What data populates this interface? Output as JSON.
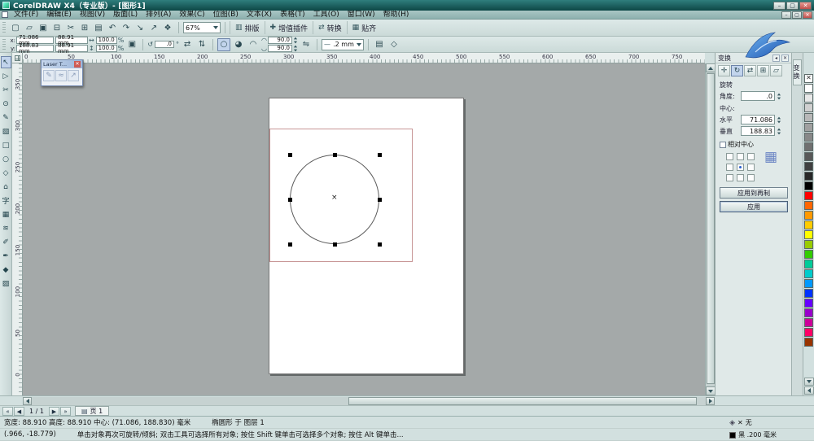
{
  "window": {
    "title": "CorelDRAW X4（专业版）- [图形1]",
    "minimize_icon": "–",
    "maximize_icon": "▢",
    "close_icon": "✕"
  },
  "menu": {
    "items": [
      {
        "name": "menu-file",
        "label": "文件(F)"
      },
      {
        "name": "menu-edit",
        "label": "编辑(E)"
      },
      {
        "name": "menu-view",
        "label": "视图(V)"
      },
      {
        "name": "menu-layout",
        "label": "版面(L)"
      },
      {
        "name": "menu-arrange",
        "label": "排列(A)"
      },
      {
        "name": "menu-effects",
        "label": "效果(C)"
      },
      {
        "name": "menu-bitmaps",
        "label": "位图(B)"
      },
      {
        "name": "menu-text",
        "label": "文本(X)"
      },
      {
        "name": "menu-table",
        "label": "表格(T)"
      },
      {
        "name": "menu-tools",
        "label": "工具(O)"
      },
      {
        "name": "menu-window",
        "label": "窗口(W)"
      },
      {
        "name": "menu-help",
        "label": "帮助(H)"
      }
    ]
  },
  "std_toolbar": {
    "icons": [
      {
        "name": "new-document-icon",
        "glyph": "▢"
      },
      {
        "name": "open-icon",
        "glyph": "▱"
      },
      {
        "name": "save-icon",
        "glyph": "▣"
      },
      {
        "name": "print-icon",
        "glyph": "⊟"
      },
      {
        "name": "cut-icon",
        "glyph": "✂"
      },
      {
        "name": "copy-icon",
        "glyph": "⊞"
      },
      {
        "name": "paste-icon",
        "glyph": "▤"
      },
      {
        "name": "undo-icon",
        "glyph": "↶"
      },
      {
        "name": "redo-icon",
        "glyph": "↷"
      },
      {
        "name": "import-icon",
        "glyph": "↘"
      },
      {
        "name": "export-icon",
        "glyph": "↗"
      },
      {
        "name": "app-launcher-icon",
        "glyph": "❖"
      }
    ],
    "zoom_value": "67%",
    "right_buttons": [
      {
        "name": "layout-button",
        "icon": "▥",
        "label": "排版"
      },
      {
        "name": "plugins-button",
        "icon": "✚",
        "label": "增值插件"
      },
      {
        "name": "convert-button",
        "icon": "⇄",
        "label": "转换"
      },
      {
        "name": "snap-button",
        "icon": "▦",
        "label": "贴齐"
      }
    ]
  },
  "property_bar": {
    "x_label": "x:",
    "x_value": "71.086 mm",
    "y_label": "y:",
    "y_value": "188.83 mm",
    "w_value": "88.91 mm",
    "h_value": "88.91 mm",
    "w_icon": "↔",
    "h_icon": "↕",
    "scale_h": "100.0",
    "scale_v": "100.0",
    "percent": "%",
    "lock_icon": "▣",
    "rotate_icon": "↺",
    "angle_value": ".0",
    "degree": "°",
    "mirror_h_icon": "⇄",
    "mirror_v_icon": "⇅",
    "ellipse_icon": "○",
    "pie_icon": "◕",
    "arc_icon": "◠",
    "arc_start_icon": "◠",
    "arc_start": "90.0",
    "arc_end_icon": "◡",
    "arc_end": "90.0",
    "direction_icon": "⇋",
    "outline_icon": "—",
    "outline_value": ".2 mm",
    "wrap_icon": "▤",
    "curves_icon": "◇"
  },
  "rulers": {
    "h_labels": [
      "0",
      "50",
      "100",
      "150",
      "200",
      "250",
      "300",
      "350",
      "400",
      "450",
      "500",
      "550",
      "600",
      "650",
      "700",
      "750"
    ],
    "v_labels": [
      "350",
      "300",
      "250",
      "200",
      "150",
      "100",
      "50",
      "0"
    ]
  },
  "toolbox": [
    {
      "name": "pick-tool",
      "glyph": "↖"
    },
    {
      "name": "shape-tool",
      "glyph": "▷"
    },
    {
      "name": "crop-tool",
      "glyph": "✂"
    },
    {
      "name": "zoom-tool",
      "glyph": "⊙"
    },
    {
      "name": "freehand-tool",
      "glyph": "✎"
    },
    {
      "name": "smart-fill-tool",
      "glyph": "▧"
    },
    {
      "name": "rectangle-tool",
      "glyph": "□"
    },
    {
      "name": "ellipse-tool",
      "glyph": "○"
    },
    {
      "name": "polygon-tool",
      "glyph": "◇"
    },
    {
      "name": "basic-shapes-tool",
      "glyph": "⌂"
    },
    {
      "name": "text-tool",
      "glyph": "字"
    },
    {
      "name": "table-tool",
      "glyph": "▦"
    },
    {
      "name": "blend-tool",
      "glyph": "≋"
    },
    {
      "name": "eyedropper-tool",
      "glyph": "✐"
    },
    {
      "name": "outline-pen-tool",
      "glyph": "✒"
    },
    {
      "name": "fill-tool",
      "glyph": "◆"
    },
    {
      "name": "interactive-fill-tool",
      "glyph": "▨"
    }
  ],
  "canvas": {
    "center_mark": "×"
  },
  "floating_toolbar": {
    "title": "Laser T...",
    "close_icon": "✕",
    "icons": [
      {
        "name": "laser-pen-icon",
        "glyph": "✎"
      },
      {
        "name": "laser-path-icon",
        "glyph": "≈"
      },
      {
        "name": "laser-arrow-icon",
        "glyph": "↗"
      }
    ]
  },
  "docker": {
    "title": "变换",
    "flyout_icon": "◂",
    "close_icon": "✕",
    "tabs": [
      {
        "name": "position-tab",
        "glyph": "✛"
      },
      {
        "name": "rotate-tab",
        "glyph": "↻"
      },
      {
        "name": "scale-mirror-tab",
        "glyph": "⇄"
      },
      {
        "name": "size-tab",
        "glyph": "⊞"
      },
      {
        "name": "skew-tab",
        "glyph": "▱"
      }
    ],
    "section_label": "旋转",
    "angle_label": "角度:",
    "angle_value": ".0",
    "center_label": "中心:",
    "horizontal_label": "水平",
    "horizontal_value": "71.086",
    "vertical_label": "垂直",
    "vertical_value": "188.83",
    "relative_center_label": "相对中心",
    "anchor_icon": "▦",
    "apply_duplicate_label": "应用到再制",
    "apply_label": "应用",
    "side_tab_label": "变换"
  },
  "palette": {
    "colors": [
      "#FFFFFF",
      "#E8E8E8",
      "#D0D0D0",
      "#B8B8B8",
      "#A0A0A0",
      "#888888",
      "#707070",
      "#585858",
      "#404040",
      "#282828",
      "#000000",
      "#FF0000",
      "#FF6600",
      "#FF9900",
      "#FFCC00",
      "#FFFF00",
      "#99CC00",
      "#33CC00",
      "#00CC99",
      "#00CCCC",
      "#0099FF",
      "#0033FF",
      "#6600FF",
      "#9900CC",
      "#CC0099",
      "#FF0066",
      "#993300"
    ]
  },
  "pagebar": {
    "first_icon": "«",
    "prev_icon": "◀",
    "indicator": "1 / 1",
    "next_icon": "▶",
    "last_icon": "»",
    "tab_icon": "▤",
    "tab_label": "页 1"
  },
  "statusbar": {
    "dims": "宽度: 88.910  高度: 88.910  中心: (71.086, 188.830) 毫米",
    "object": "椭圆形 于 图层 1",
    "coords": "(.966, -18.779)",
    "hint": "单击对象再次可旋转/倾斜; 双击工具可选择所有对象; 按住 Shift 键单击可选择多个对象; 按住 Alt 键单击...",
    "fill_icon": "◈",
    "fill_mark": "✕",
    "fill_value": "无",
    "outline_value": "黑 .200 毫米"
  }
}
